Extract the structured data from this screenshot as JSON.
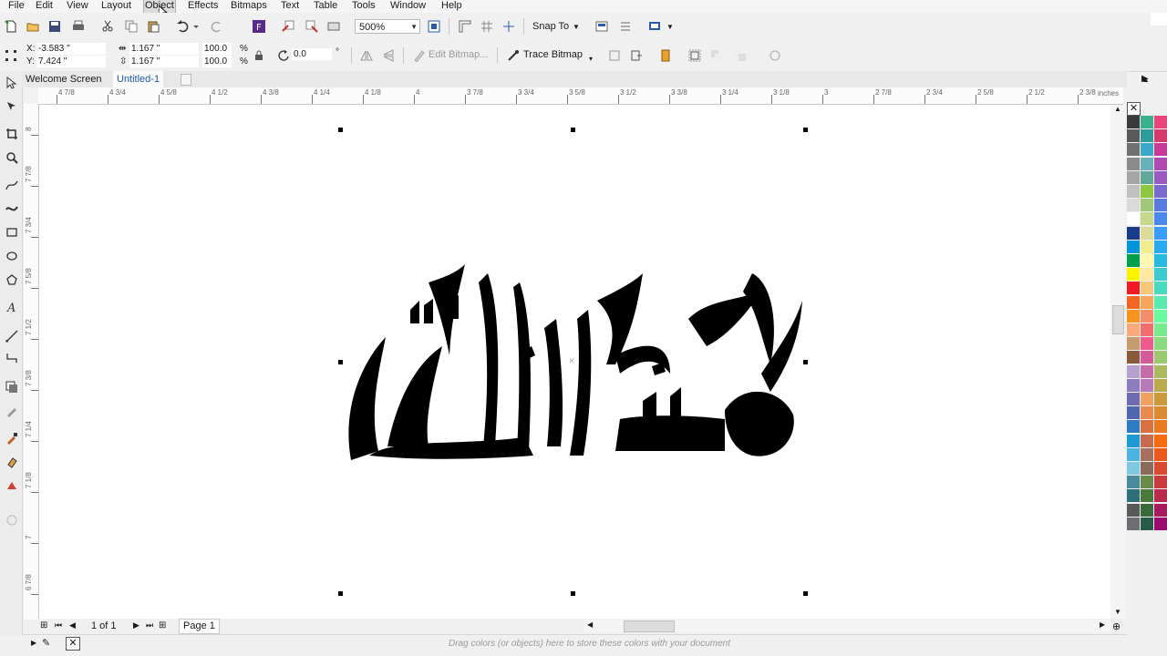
{
  "menu": [
    "File",
    "Edit",
    "View",
    "Layout",
    "Object",
    "Effects",
    "Bitmaps",
    "Text",
    "Table",
    "Tools",
    "Window",
    "Help"
  ],
  "menu_hover": "Object",
  "toolbar": {
    "zoom_value": "500%",
    "snap_label": "Snap To"
  },
  "property_bar": {
    "x_label": "X:",
    "x_value": "-3.583 \"",
    "y_label": "Y:",
    "y_value": "7.424 \"",
    "width_value": "1.167 \"",
    "height_value": "1.167 \"",
    "scale_w": "100.0",
    "scale_h": "100.0",
    "percent": "%",
    "rotation_value": "0.0",
    "degree": "°",
    "edit_bitmap_label": "Edit Bitmap...",
    "trace_bitmap_label": "Trace Bitmap"
  },
  "tabs": [
    "Welcome Screen",
    "Untitled-1"
  ],
  "active_tab": "Untitled-1",
  "ruler": {
    "unit": "inches",
    "h_labels": [
      "4 7/8",
      "4 3/4",
      "4 5/8",
      "4 1/2",
      "4 3/8",
      "4 1/4",
      "4 1/8",
      "4",
      "3 7/8",
      "3 3/4",
      "3 5/8",
      "3 1/2",
      "3 3/8",
      "3 1/4",
      "3 1/8",
      "3",
      "2 7/8",
      "2 3/4",
      "2 5/8",
      "2 1/2",
      "2 3/8"
    ],
    "v_labels": [
      "8",
      "7 7/8",
      "7 3/4",
      "7 5/8",
      "7 1/2",
      "7 3/8",
      "7 1/4",
      "7 1/8",
      "7",
      "6 7/8"
    ]
  },
  "page_nav": {
    "page_count": "1 of 1",
    "page_tab": "Page 1"
  },
  "status": {
    "hint": "Drag colors (or objects) here to store these colors with your document"
  },
  "palette": {
    "col1": [
      "#3a3a3a",
      "#5a5a5a",
      "#707070",
      "#8a8a8a",
      "#a5a5a5",
      "#c0c0c0",
      "#dadada",
      "#ffffff",
      "#1a3a8a",
      "#0095da",
      "#00a04a",
      "#fff200",
      "#ed1c24",
      "#f26522",
      "#f7941d",
      "#f9a97a",
      "#c69c6d",
      "#8b5a3c",
      "#b5a0d0",
      "#8c7bbf",
      "#6d6ab2",
      "#4e66b0",
      "#2e7bc4",
      "#1b9ad6",
      "#4ab3e0",
      "#7ec8e3",
      "#4a8a9a",
      "#2f6f7a",
      "#58595b",
      "#6d6e71"
    ],
    "col2": [
      "#3ab08f",
      "#2d9b9b",
      "#3aa8c8",
      "#6ab0b8",
      "#5fa89a",
      "#8dc63f",
      "#a0c878",
      "#c6d88a",
      "#dcdc9a",
      "#f2ee8f",
      "#fff9b0",
      "#fde9a0",
      "#f8c87a",
      "#f6a65a",
      "#f58c6a",
      "#f26e6e",
      "#ee5a8a",
      "#d65a9a",
      "#c86aa8",
      "#b87ab8",
      "#f0a060",
      "#e88a50",
      "#d87040",
      "#c86a50",
      "#a87060",
      "#8a6a5a",
      "#6a8a4a",
      "#4a7a3a",
      "#3a6a3a",
      "#2a5a4a"
    ],
    "col3": [
      "#e8457a",
      "#d63a6a",
      "#c83a9a",
      "#b04ab0",
      "#9a5abf",
      "#7a6acf",
      "#5a7adf",
      "#4a8aef",
      "#3a9aff",
      "#2aaaef",
      "#2abadf",
      "#3acacf",
      "#4adabf",
      "#5aeaaf",
      "#6afa9f",
      "#7aea8f",
      "#8ada7f",
      "#9aca6f",
      "#aaba5f",
      "#baaa4f",
      "#ca9a3f",
      "#da8a2f",
      "#ea7a1f",
      "#fa6a0f",
      "#ea5a1f",
      "#da4a2f",
      "#ca3a3f",
      "#ba2a4f",
      "#aa1a5f",
      "#9a0a6f"
    ]
  }
}
